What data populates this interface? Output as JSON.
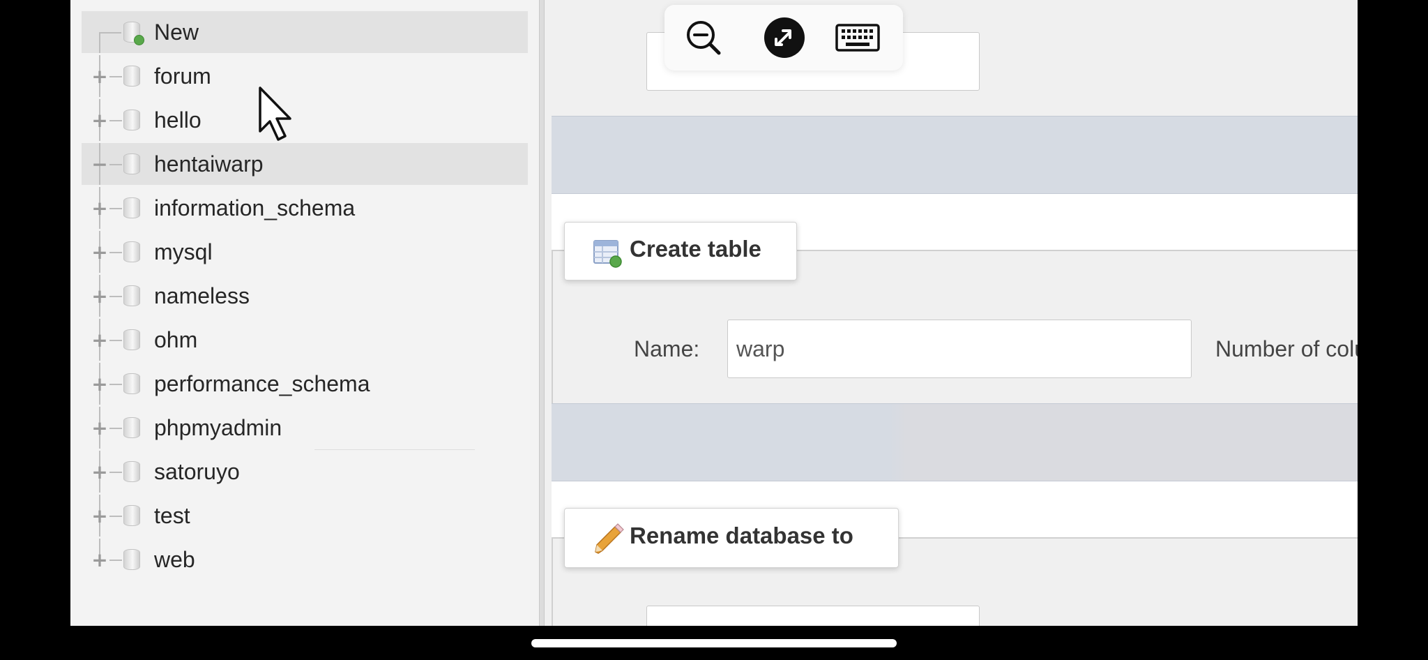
{
  "navigation": {
    "new_label": "New",
    "databases": [
      {
        "name": "forum",
        "expanded": false
      },
      {
        "name": "hello",
        "expanded": false
      },
      {
        "name": "hentaiwarp",
        "expanded": true
      },
      {
        "name": "information_schema",
        "expanded": false
      },
      {
        "name": "mysql",
        "expanded": false
      },
      {
        "name": "nameless",
        "expanded": false
      },
      {
        "name": "ohm",
        "expanded": false
      },
      {
        "name": "performance_schema",
        "expanded": false
      },
      {
        "name": "phpmyadmin",
        "expanded": false
      },
      {
        "name": "satoruyo",
        "expanded": false
      },
      {
        "name": "test",
        "expanded": false
      },
      {
        "name": "web",
        "expanded": false
      }
    ],
    "expand_glyph": "+",
    "collapse_glyph": "−"
  },
  "create_table": {
    "legend": "Create table",
    "name_label": "Name:",
    "name_value": "warp",
    "columns_label": "Number of columns"
  },
  "rename_database": {
    "legend": "Rename database to"
  },
  "toolbar": {
    "icons": [
      "zoom-out-icon",
      "remote-connection-icon",
      "keyboard-icon"
    ]
  },
  "colors": {
    "band": "#d6dbe3",
    "tree_highlight": "#e2e2e2",
    "new_badge": "#59a84b",
    "pencil": "#e8a33a"
  }
}
